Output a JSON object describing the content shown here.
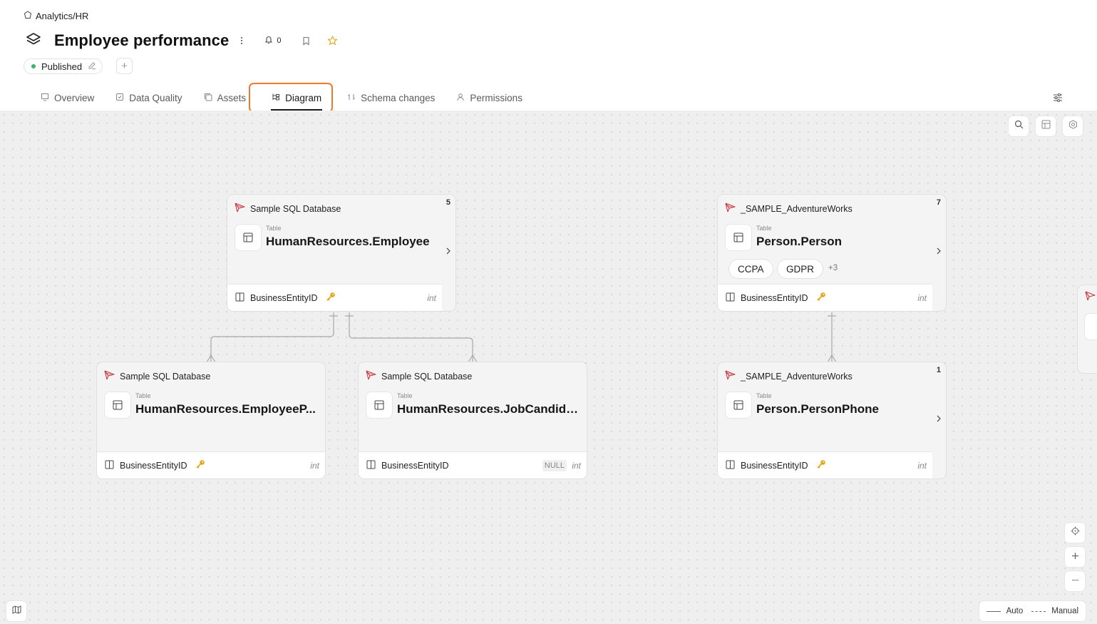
{
  "breadcrumb": {
    "text": "Analytics/HR",
    "icon": "workspace-icon"
  },
  "header": {
    "title": "Employee performance",
    "notifications_count": "0",
    "status_label": "Published",
    "status_color": "#3fb26b"
  },
  "tabs": [
    {
      "label": "Overview",
      "icon": "overview-icon"
    },
    {
      "label": "Data Quality",
      "icon": "data-quality-icon"
    },
    {
      "label": "Assets",
      "icon": "assets-icon"
    },
    {
      "label": "Diagram",
      "icon": "diagram-icon",
      "active": true
    },
    {
      "label": "Schema changes",
      "icon": "schema-changes-icon"
    },
    {
      "label": "Permissions",
      "icon": "permissions-icon"
    }
  ],
  "nodes": [
    {
      "source": "Sample SQL Database",
      "count": "5",
      "kind": "Table",
      "name": "HumanResources.Employee",
      "field": "BusinessEntityID",
      "type": "int",
      "key": true,
      "tags": []
    },
    {
      "source": "_SAMPLE_AdventureWorks",
      "count": "7",
      "kind": "Table",
      "name": "Person.Person",
      "field": "BusinessEntityID",
      "type": "int",
      "key": true,
      "tags": [
        "CCPA",
        "GDPR"
      ],
      "more_tags": "+3"
    },
    {
      "source": "Sample SQL Database",
      "count": "",
      "kind": "Table",
      "name": "HumanResources.EmployeeP...",
      "field": "BusinessEntityID",
      "type": "int",
      "key": true,
      "tags": []
    },
    {
      "source": "Sample SQL Database",
      "count": "",
      "kind": "Table",
      "name": "HumanResources.JobCandidate",
      "field": "BusinessEntityID",
      "type": "int",
      "key": false,
      "null_label": "NULL",
      "tags": []
    },
    {
      "source": "_SAMPLE_AdventureWorks",
      "count": "1",
      "kind": "Table",
      "name": "Person.PersonPhone",
      "field": "BusinessEntityID",
      "type": "int",
      "key": true,
      "tags": []
    }
  ],
  "legend": {
    "auto_label": "Auto",
    "manual_label": "Manual"
  },
  "colors": {
    "accent_highlight": "#f07a2a",
    "key_icon": "#e0a81c",
    "db_icon": "#c8363f"
  }
}
